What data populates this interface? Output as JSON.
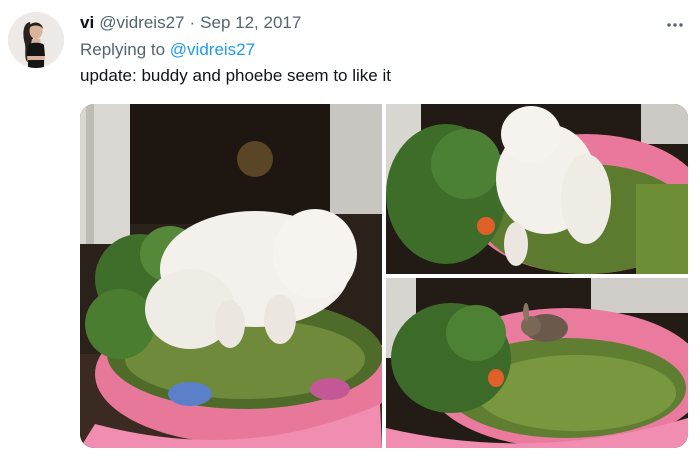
{
  "tweet": {
    "display_name": "vi",
    "handle": "@vidreis27",
    "separator": "·",
    "date": "Sep 12, 2017",
    "reply_prefix": "Replying to",
    "reply_to": "@vidreis27",
    "text": "update: buddy and phoebe seem to like it"
  },
  "icons": {
    "avatar": "profile-photo",
    "more": "more-horizontal-icon"
  },
  "media": {
    "photos": [
      {
        "subject": "white-dog-eating-grass-in-pink-pool"
      },
      {
        "subject": "white-dog-from-behind-in-pink-pool"
      },
      {
        "subject": "rabbit-on-grass-in-pink-pool"
      }
    ]
  },
  "colors": {
    "link": "#1d9bf0",
    "secondary_text": "#536471",
    "primary_text": "#0f1419"
  }
}
